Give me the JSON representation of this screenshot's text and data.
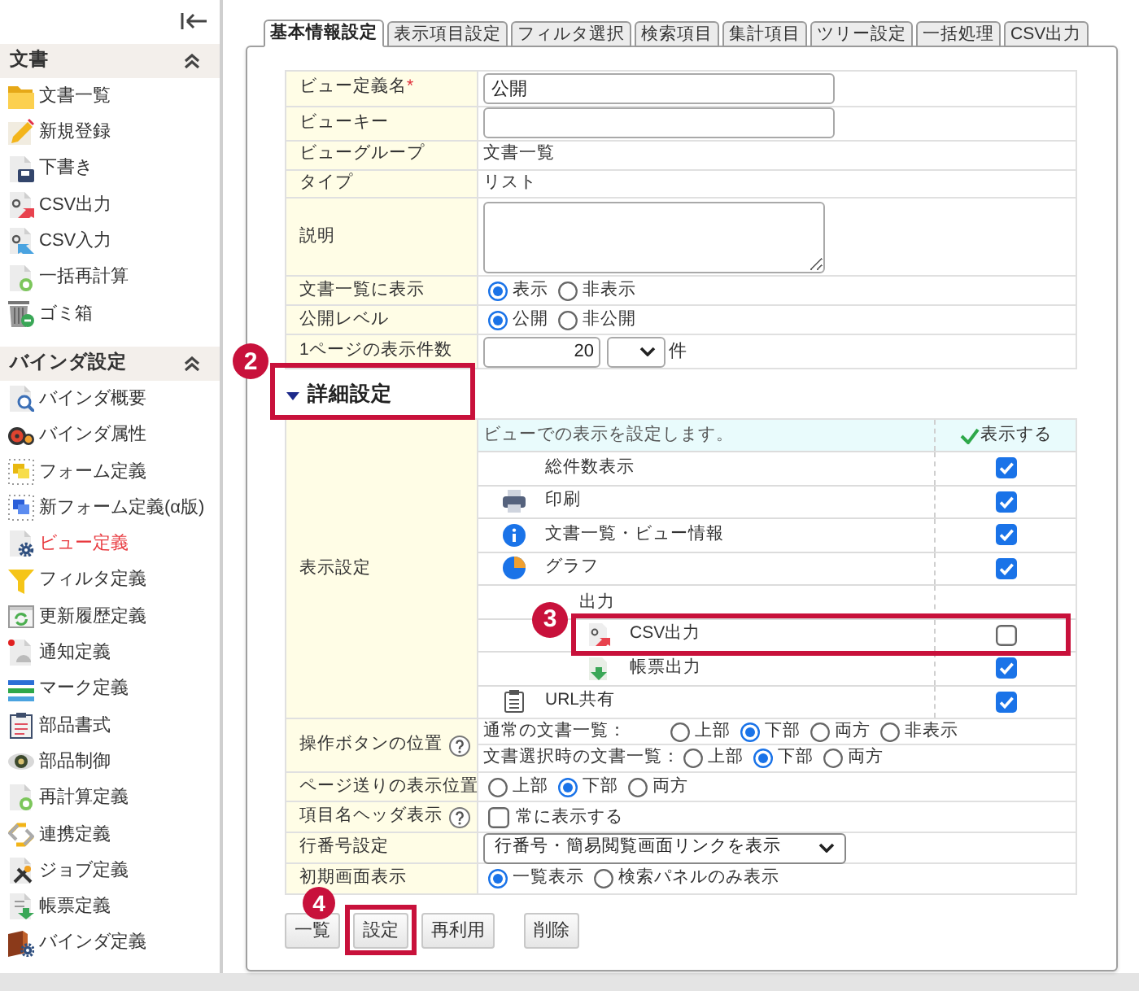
{
  "sidebar": {
    "sections": [
      {
        "title": "文書",
        "expanded": true,
        "items": [
          {
            "label": "文書一覧",
            "kind": "folder",
            "selected": false
          },
          {
            "label": "新規登録",
            "kind": "pencil",
            "selected": false
          },
          {
            "label": "下書き",
            "kind": "draft",
            "selected": false
          },
          {
            "label": "CSV出力",
            "kind": "export",
            "selected": false
          },
          {
            "label": "CSV入力",
            "kind": "import",
            "selected": false
          },
          {
            "label": "一括再計算",
            "kind": "recalc",
            "selected": false
          },
          {
            "label": "ゴミ箱",
            "kind": "trash",
            "selected": false
          }
        ]
      },
      {
        "title": "バインダ設定",
        "expanded": true,
        "items": [
          {
            "label": "バインダ概要",
            "kind": "overview",
            "selected": false
          },
          {
            "label": "バインダ属性",
            "kind": "gears",
            "selected": false
          },
          {
            "label": "フォーム定義",
            "kind": "form",
            "selected": false
          },
          {
            "label": "新フォーム定義(α版)",
            "kind": "form-new",
            "selected": false
          },
          {
            "label": "ビュー定義",
            "kind": "view",
            "selected": true
          },
          {
            "label": "フィルタ定義",
            "kind": "filter",
            "selected": false
          },
          {
            "label": "更新履歴定義",
            "kind": "history",
            "selected": false
          },
          {
            "label": "通知定義",
            "kind": "notify",
            "selected": false
          },
          {
            "label": "マーク定義",
            "kind": "mark",
            "selected": false
          },
          {
            "label": "部品書式",
            "kind": "format",
            "selected": false
          },
          {
            "label": "部品制御",
            "kind": "eye",
            "selected": false
          },
          {
            "label": "再計算定義",
            "kind": "recalc",
            "selected": false
          },
          {
            "label": "連携定義",
            "kind": "link",
            "selected": false
          },
          {
            "label": "ジョブ定義",
            "kind": "job",
            "selected": false
          },
          {
            "label": "帳票定義",
            "kind": "report",
            "selected": false
          },
          {
            "label": "バインダ定義",
            "kind": "binder",
            "selected": false
          }
        ]
      }
    ]
  },
  "tabs": [
    {
      "label": "基本情報設定",
      "selected": true
    },
    {
      "label": "表示項目設定",
      "selected": false
    },
    {
      "label": "フィルタ選択",
      "selected": false
    },
    {
      "label": "検索項目",
      "selected": false
    },
    {
      "label": "集計項目",
      "selected": false
    },
    {
      "label": "ツリー設定",
      "selected": false
    },
    {
      "label": "一括処理",
      "selected": false
    },
    {
      "label": "CSV出力",
      "selected": false
    }
  ],
  "form": {
    "rows": [
      {
        "kind": "input",
        "label": "ビュー定義名",
        "required_mark": "*",
        "value": "公開"
      },
      {
        "kind": "input",
        "label": "ビューキー"
      },
      {
        "kind": "text",
        "label": "ビューグループ",
        "value": "文書一覧"
      },
      {
        "kind": "text",
        "label": "タイプ",
        "value": "リスト"
      },
      {
        "kind": "textarea",
        "label": "説明"
      },
      {
        "kind": "radio",
        "label": "文書一覧に表示",
        "options": [
          {
            "label": "表示",
            "selected": true
          },
          {
            "label": "非表示",
            "selected": false
          }
        ]
      },
      {
        "kind": "radio",
        "label": "公開レベル",
        "options": [
          {
            "label": "公開",
            "selected": true
          },
          {
            "label": "非公開",
            "selected": false
          }
        ]
      },
      {
        "kind": "count",
        "label": "1ページの表示件数",
        "value": "20",
        "unit": "件"
      }
    ]
  },
  "details": {
    "title": "詳細設定",
    "expanded": true,
    "callout": "2",
    "rows": [
      {
        "kind": "display-list",
        "label": "表示設定",
        "header": "ビューでの表示を設定します。",
        "column_header": "表示する",
        "items": [
          {
            "kind": "plain",
            "label": "総件数表示",
            "checked": true
          },
          {
            "kind": "printer",
            "label": "印刷",
            "checked": true
          },
          {
            "kind": "info",
            "label": "文書一覧・ビュー情報",
            "checked": true
          },
          {
            "kind": "chart",
            "label": "グラフ",
            "checked": true
          },
          {
            "kind": "group",
            "label": "出力",
            "children": [
              {
                "kind": "csv",
                "label": "CSV出力",
                "checked": false,
                "callout": "3"
              },
              {
                "kind": "report",
                "label": "帳票出力",
                "checked": true
              }
            ]
          },
          {
            "kind": "clipboard",
            "label": "URL共有",
            "checked": true
          }
        ]
      },
      {
        "kind": "radio-groups",
        "label": "操作ボタンの位置",
        "help": true,
        "groups": [
          {
            "label": "通常の文書一覧：",
            "options": [
              {
                "label": "上部",
                "selected": false
              },
              {
                "label": "下部",
                "selected": true
              },
              {
                "label": "両方",
                "selected": false
              },
              {
                "label": "非表示",
                "selected": false
              }
            ]
          },
          {
            "label": "文書選択時の文書一覧：",
            "options": [
              {
                "label": "上部",
                "selected": false
              },
              {
                "label": "下部",
                "selected": true
              },
              {
                "label": "両方",
                "selected": false
              }
            ]
          }
        ]
      },
      {
        "kind": "radio",
        "label": "ページ送りの表示位置",
        "options": [
          {
            "label": "上部",
            "selected": false
          },
          {
            "label": "下部",
            "selected": true
          },
          {
            "label": "両方",
            "selected": false
          }
        ]
      },
      {
        "kind": "checkbox",
        "label": "項目名ヘッダ表示",
        "help": true,
        "option": {
          "label": "常に表示する",
          "checked": false
        }
      },
      {
        "kind": "select",
        "label": "行番号設定",
        "value": "行番号・簡易閲覧画面リンクを表示"
      },
      {
        "kind": "radio",
        "label": "初期画面表示",
        "options": [
          {
            "label": "一覧表示",
            "selected": true
          },
          {
            "label": "検索パネルのみ表示",
            "selected": false
          }
        ]
      }
    ]
  },
  "buttons": [
    {
      "label": "一覧"
    },
    {
      "label": "設定",
      "callout": "4"
    },
    {
      "label": "再利用"
    },
    {
      "label": "削除"
    }
  ]
}
